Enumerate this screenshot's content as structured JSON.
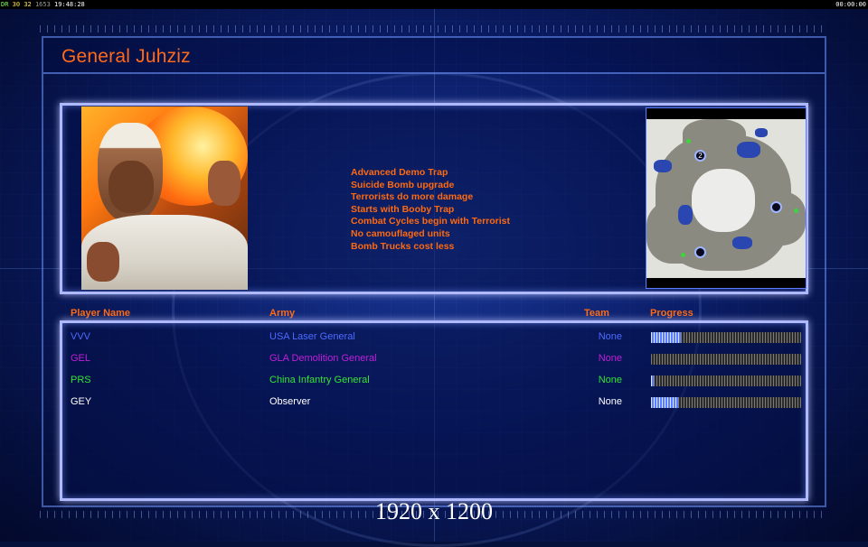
{
  "hud": {
    "fps_label": "DR",
    "fps_a": "30",
    "fps_b": "32",
    "fps_c": "1653",
    "clock_left": "19:48:28",
    "clock_right": "00:00:00"
  },
  "general_name": "General Juhziz",
  "traits": [
    "Advanced Demo Trap",
    "Suicide Bomb upgrade",
    "Terrorists do more damage",
    "Starts with Booby Trap",
    "Combat Cycles begin with Terrorist",
    "No camouflaged units",
    "Bomb Trucks cost less"
  ],
  "minimap": {
    "start_marker_label": "2"
  },
  "table": {
    "headers": {
      "name": "Player Name",
      "army": "Army",
      "team": "Team",
      "progress": "Progress"
    },
    "players": [
      {
        "name": "VVV",
        "army": "USA Laser General",
        "team": "None",
        "progress": 0.2,
        "color": "#4d6bff"
      },
      {
        "name": "GEL",
        "army": "GLA Demolition General",
        "team": "None",
        "progress": 0.0,
        "color": "#c020d6"
      },
      {
        "name": "PRS",
        "army": "China Infantry General",
        "team": "None",
        "progress": 0.02,
        "color": "#33e533"
      },
      {
        "name": "GEY",
        "army": "Observer",
        "team": "None",
        "progress": 0.18,
        "color": "#ffffff"
      }
    ]
  },
  "resolution_caption": "1920 x 1200",
  "colors": {
    "accent": "#ff6a10",
    "panel_border": "#aeb9ff",
    "background": "#0a1a5a"
  }
}
